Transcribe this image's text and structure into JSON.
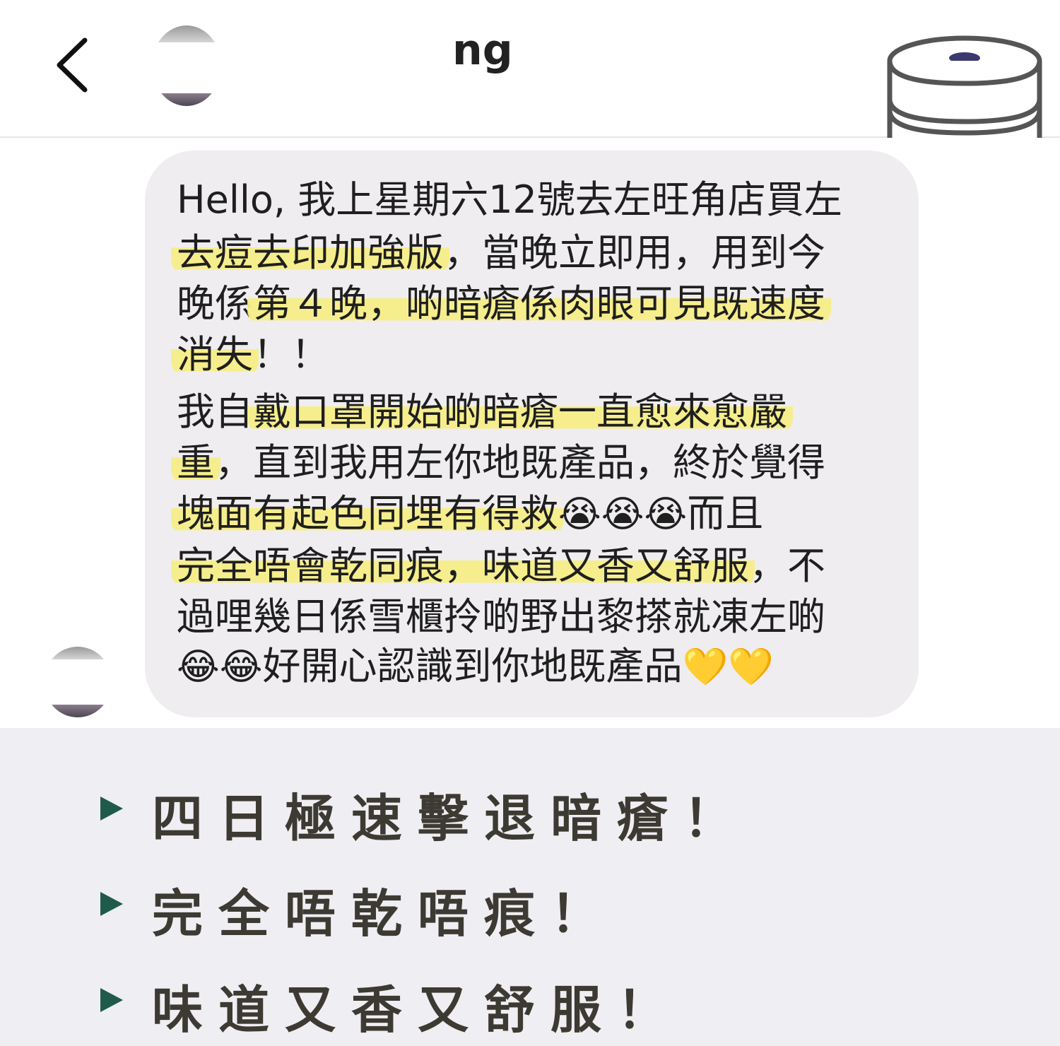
{
  "header": {
    "contact_name": "ng"
  },
  "message": {
    "lines": [
      [
        "Hello, 我上星期六12號去左旺角店買左",
        "",
        ""
      ],
      [
        "",
        "去痘去印加強版",
        "，當晚立即用，用到今"
      ],
      [
        "晚係",
        "第４晚，啲暗瘡係肉眼可見既速度",
        ""
      ],
      [
        "",
        "消失",
        "！！"
      ],
      [
        "我自",
        "戴口罩開始啲暗瘡一直愈來愈嚴",
        ""
      ],
      [
        "",
        "重",
        "，直到我用左你地既產品，終於覺得"
      ],
      [
        "",
        "塊面有起色同埋有得救",
        ""
      ],
      [
        "",
        "完全唔會乾同痕，味道又香又舒服",
        "，不"
      ],
      [
        "過哩幾日係雪櫃拎啲野出黎搽就凍左啲",
        "",
        ""
      ],
      [
        "",
        "",
        "好開心認識到你地既產品"
      ]
    ],
    "emoji": {
      "crying": "😭",
      "laughing": "😂",
      "heart": "💛"
    },
    "line7_tail": "而且"
  },
  "promo": {
    "items": [
      "四日極速擊退暗瘡！",
      "完全唔乾唔痕！",
      "味道又香又舒服！"
    ]
  },
  "colors": {
    "highlight": "#f6ee88",
    "bubble": "#efedf0",
    "promo_bg": "#efeef2",
    "promo_text": "#3d3a33",
    "marker": "#1f5a4a"
  }
}
